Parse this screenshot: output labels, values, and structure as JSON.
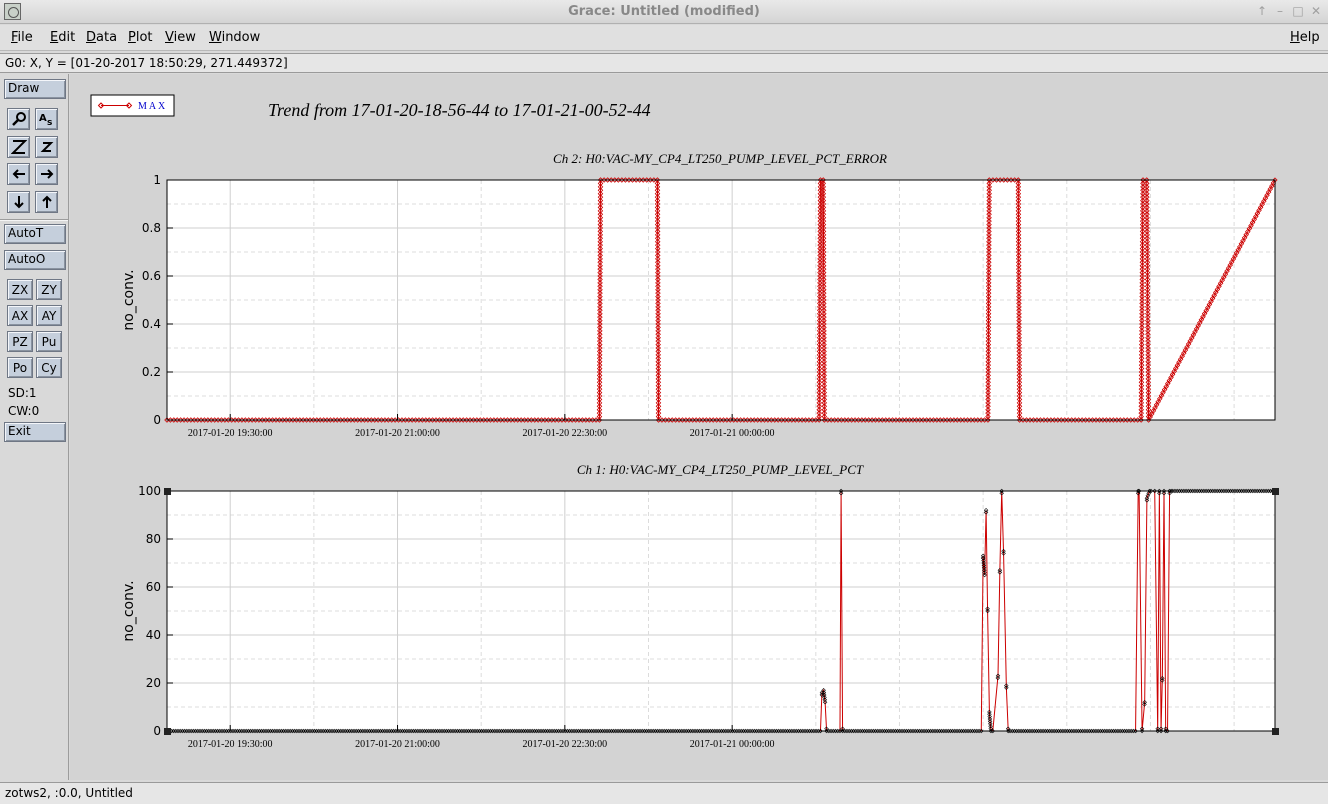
{
  "window": {
    "title": "Grace: Untitled (modified)",
    "controls": [
      "↑",
      "–",
      "□",
      "✕"
    ]
  },
  "menu": {
    "file": {
      "mn": "F",
      "rest": "ile"
    },
    "edit": {
      "mn": "E",
      "rest": "dit"
    },
    "data": {
      "mn": "D",
      "rest": "ata"
    },
    "plot": {
      "mn": "P",
      "rest": "lot"
    },
    "view": {
      "mn": "V",
      "rest": "iew"
    },
    "window": {
      "mn": "W",
      "rest": "indow"
    },
    "help": {
      "mn": "H",
      "rest": "elp"
    }
  },
  "locator": "G0: X, Y = [01-20-2017 18:50:29, 271.449372]",
  "toolbox": {
    "draw": "Draw",
    "autot": "AutoT",
    "autoo": "AutoO",
    "zx": "ZX",
    "zy": "ZY",
    "ax": "AX",
    "ay": "AY",
    "pz": "PZ",
    "pu": "Pu",
    "po": "Po",
    "cy": "Cy",
    "sd": "SD:1",
    "cw": "CW:0",
    "exit": "Exit",
    "icons": [
      "magnifier-icon",
      "text-tool-icon",
      "zoom-z-icon",
      "zoom-z-small-icon",
      "arrow-left-icon",
      "arrow-right-icon",
      "arrow-down-icon",
      "arrow-up-icon"
    ]
  },
  "status": "zotws2, :0.0, Untitled",
  "graph": {
    "title": "Trend from 17-01-20-18-56-44 to 17-01-21-00-52-44",
    "legend_label": "M A X",
    "series_color": "#cc0000"
  },
  "chart_data": [
    {
      "type": "line",
      "title": "Ch 2: H0:VAC-MY_CP4_LT250_PUMP_LEVEL_PCT_ERROR",
      "ylabel": "no_conv.",
      "xlabel": "",
      "x_ticks": [
        "2017-01-20 19:30:00",
        "2017-01-20 21:00:00",
        "2017-01-20 22:30:00",
        "2017-01-21 00:00:00"
      ],
      "y_ticks": [
        "0",
        "0.2",
        "0.4",
        "0.6",
        "0.8",
        "1"
      ],
      "ylim": [
        0,
        1
      ],
      "grid": true,
      "series": [
        {
          "name": "MAX",
          "x_minutes": [
            0,
            232.6,
            233.2,
            263.8,
            264.4,
            350.8,
            351.5,
            353.0,
            353.6,
            441.6,
            442.3,
            457.9,
            458.6,
            524.0,
            525.0,
            527.0,
            528.0,
            596.0
          ],
          "values": [
            0,
            0,
            1,
            1,
            0,
            0,
            1,
            1,
            0,
            0,
            1,
            1,
            0,
            0,
            1,
            1,
            0,
            1
          ]
        }
      ]
    },
    {
      "type": "line",
      "title": "Ch 1: H0:VAC-MY_CP4_LT250_PUMP_LEVEL_PCT",
      "ylabel": "no_conv.",
      "xlabel": "",
      "x_ticks": [
        "2017-01-20 19:30:00",
        "2017-01-20 21:00:00",
        "2017-01-20 22:30:00",
        "2017-01-21 00:00:00"
      ],
      "y_ticks": [
        "0",
        "20",
        "40",
        "60",
        "80",
        "100"
      ],
      "ylim": [
        0,
        100
      ],
      "grid": true,
      "series": [
        {
          "name": "MAX",
          "x_minutes": [
            0,
            351.5,
            352.3,
            353.2,
            354.0,
            354.8,
            362.0,
            362.6,
            363.4,
            438.0,
            439.0,
            439.8,
            440.6,
            441.4,
            442.4,
            443.2,
            444.2,
            447.0,
            448.0,
            449.0,
            450.0,
            451.5,
            452.5,
            453.5,
            521.0,
            522.4,
            522.9,
            524.5,
            525.9,
            527.1,
            528.5,
            529.3,
            531.3,
            532.9,
            533.8,
            534.7,
            535.4,
            536.3,
            537.2,
            538.2,
            539.3,
            540.2,
            541.0,
            596.0
          ],
          "values": [
            0,
            0,
            16,
            17,
            12,
            0,
            0,
            100,
            0,
            0,
            73,
            65,
            92,
            50,
            7,
            0,
            0,
            23,
            67,
            100,
            74,
            18,
            0,
            0,
            0,
            100,
            100,
            0,
            12,
            97,
            100,
            100,
            100,
            0,
            100,
            0,
            22,
            100,
            0,
            0,
            100,
            100,
            100,
            100
          ]
        }
      ]
    }
  ]
}
